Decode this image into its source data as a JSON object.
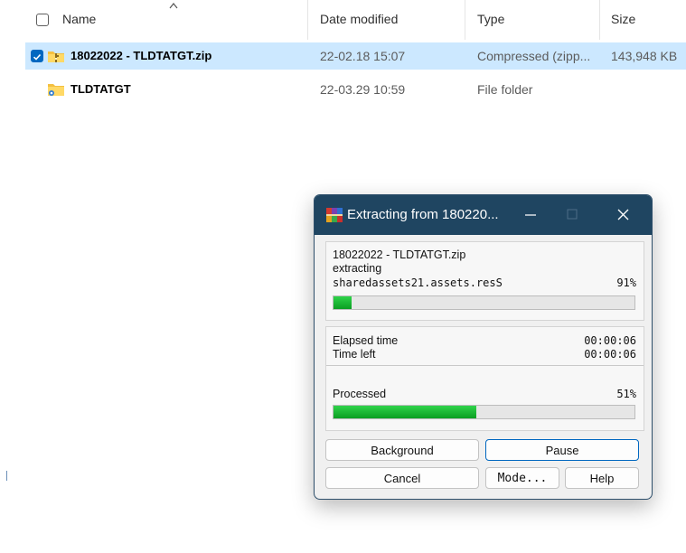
{
  "explorer": {
    "columns": {
      "name": "Name",
      "date": "Date modified",
      "type": "Type",
      "size": "Size"
    },
    "files": [
      {
        "name": "18022022 - TLDTATGT.zip",
        "date": "22-02.18 15:07",
        "type": "Compressed (zipp...",
        "size": "143,948 KB",
        "selected": true,
        "icon": "zip-folder-icon"
      },
      {
        "name": "TLDTATGT",
        "date": "22-03.29 10:59",
        "type": "File folder",
        "size": "",
        "selected": false,
        "icon": "folder-icon"
      }
    ]
  },
  "dialog": {
    "title": "Extracting from 180220...",
    "archive": "18022022 - TLDTATGT.zip",
    "action": "extracting",
    "current_file": "sharedassets21.assets.resS",
    "file_percent_label": "91%",
    "file_progress": 0.06,
    "elapsed_label": "Elapsed time",
    "elapsed_value": "00:00:06",
    "time_left_label": "Time left",
    "time_left_value": "00:00:06",
    "processed_label": "Processed",
    "processed_percent_label": "51%",
    "processed_progress": 0.475,
    "buttons": {
      "background": "Background",
      "pause": "Pause",
      "cancel": "Cancel",
      "mode": "Mode...",
      "help": "Help"
    },
    "colors": {
      "titlebar": "#1f4561",
      "progress_fill": "#0b9e22",
      "accent": "#0067c0"
    }
  }
}
